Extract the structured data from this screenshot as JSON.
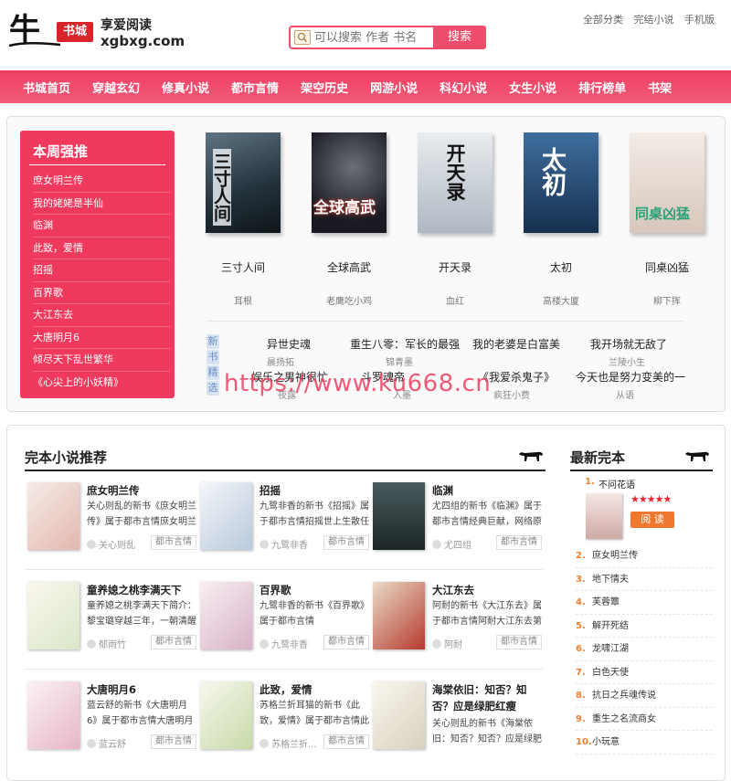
{
  "header": {
    "logo_char": "牛",
    "logo_badge": "书城",
    "slogan": "享爱阅读",
    "domain": "xgbxg.com",
    "search_placeholder": "可以搜索 作者 书名",
    "search_button": "搜索",
    "top_links": [
      "全部分类",
      "完结小说",
      "手机版"
    ]
  },
  "nav": [
    "书城首页",
    "穿越玄幻",
    "修真小说",
    "都市言情",
    "架空历史",
    "网游小说",
    "科幻小说",
    "女生小说",
    "排行榜单",
    "书架"
  ],
  "weekly": {
    "title": "本周强推",
    "items": [
      "庶女明兰传",
      "我的姥姥是半仙",
      "临渊",
      "此致，爱情",
      "招摇",
      "百界歌",
      "大江东去",
      "大唐明月6",
      "倾尽天下乱世繁华",
      "《心尖上的小妖精》"
    ]
  },
  "featured": [
    {
      "title": "三寸人间",
      "author": "耳根",
      "cover_text": "三寸人间",
      "bg": "#2f3b44"
    },
    {
      "title": "全球高武",
      "author": "老鹰吃小鸡",
      "cover_text": "全球高武",
      "bg": "#1a1b22"
    },
    {
      "title": "开天录",
      "author": "血红",
      "cover_text": "开天录",
      "bg": "#c9ced6"
    },
    {
      "title": "太初",
      "author": "高楼大厦",
      "cover_text": "太初",
      "bg": "#24456e"
    },
    {
      "title": "同桌凶猛",
      "author": "柳下挥",
      "cover_text": "同桌凶猛",
      "bg": "#e9dfd8"
    }
  ],
  "new_books": {
    "tag": [
      "新",
      "书",
      "精",
      "选"
    ],
    "items": [
      {
        "title": "异世史魂",
        "author": "晨扬拓"
      },
      {
        "title": "重生八零：军长的最强",
        "author": "锦青墨"
      },
      {
        "title": "我的老婆是白富美",
        "author": ""
      },
      {
        "title": "我开场就无敌了",
        "author": "兰陵小生"
      },
      {
        "title": "娱乐之男神很忙",
        "author": "夜露"
      },
      {
        "title": "斗罗魂帝",
        "author": "入墨"
      },
      {
        "title": "《我爱杀鬼子》",
        "author": "疯狂小费"
      },
      {
        "title": "今天也是努力变美的一",
        "author": "从语"
      }
    ]
  },
  "watermark": "https://www.ku668.cn",
  "complete": {
    "title": "完本小说推荐",
    "books": [
      {
        "title": "庶女明兰传",
        "desc": "关心则乱的新书《庶女明兰传》属于都市言情庶女明兰",
        "author": "关心则乱",
        "category": "都市言情",
        "bg": "#f3e6e0"
      },
      {
        "title": "招摇",
        "desc": "九鹭非香的新书《招摇》属于都市言情招摇世上生散任",
        "author": "九鹭非香",
        "category": "都市言情",
        "bg": "#e8eef5"
      },
      {
        "title": "临渊",
        "desc": "尤四组的新书《临渊》属于都市言情经典巨献，网络原",
        "author": "尤四组",
        "category": "都市言情",
        "bg": "#2c3a3c"
      },
      {
        "title": "童养媳之桃李满天下",
        "desc": "童养媳之桃李满天下简介：黎宝璐穿越三年，一朝清醒",
        "author": "郁雨竹",
        "category": "都市言情",
        "bg": "#f5f0e6"
      },
      {
        "title": "百界歌",
        "desc": "九鹭非香的新书《百界歌》属于都市言情",
        "author": "九鹭非香",
        "category": "都市言情",
        "bg": "#f0dfe6"
      },
      {
        "title": "大江东去",
        "desc": "阿耐的新书《大江东去》属于都市言情阿耐大江东去第",
        "author": "阿耐",
        "category": "都市言情",
        "bg": "#c8463a"
      },
      {
        "title": "大唐明月6",
        "desc": "蓝云舒的新书《大唐明月6》属于都市言情大唐明月6",
        "author": "蓝云舒",
        "category": "都市言情",
        "bg": "#f4e4ea"
      },
      {
        "title": "此致，爱情",
        "desc": "苏格兰折耳猫的新书《此致，爱情》属于都市言情此",
        "author": "苏格兰折...",
        "category": "都市言情",
        "bg": "#eef0e4"
      },
      {
        "title": "海棠依旧：知否？知否？应是绿肥红瘦",
        "desc": "关心则乱的新书《海棠依旧：知否？知否？应是绿肥",
        "author": "关心则乱",
        "category": "都市言情",
        "bg": "#f5f2ea"
      }
    ]
  },
  "latest": {
    "title": "最新完本",
    "first": {
      "num": "1.",
      "title": "不问花语",
      "stars": "★★★★★",
      "button": "阅 读"
    },
    "items": [
      {
        "num": "2.",
        "title": "庶女明兰传"
      },
      {
        "num": "3.",
        "title": "地下情夫"
      },
      {
        "num": "4.",
        "title": "芙蓉簟"
      },
      {
        "num": "5.",
        "title": "解开死结"
      },
      {
        "num": "6.",
        "title": "龙啸江湖"
      },
      {
        "num": "7.",
        "title": "白色天使"
      },
      {
        "num": "8.",
        "title": "抗日之兵魂传说"
      },
      {
        "num": "9.",
        "title": "重生之名流商女"
      },
      {
        "num": "10.",
        "title": "小玩意"
      }
    ]
  },
  "colors": {
    "brand": "#ef4d6b",
    "nav": "#ef3f63",
    "accent_orange": "#f0772e"
  },
  "icons": [
    "search-icon",
    "bull-icon"
  ]
}
